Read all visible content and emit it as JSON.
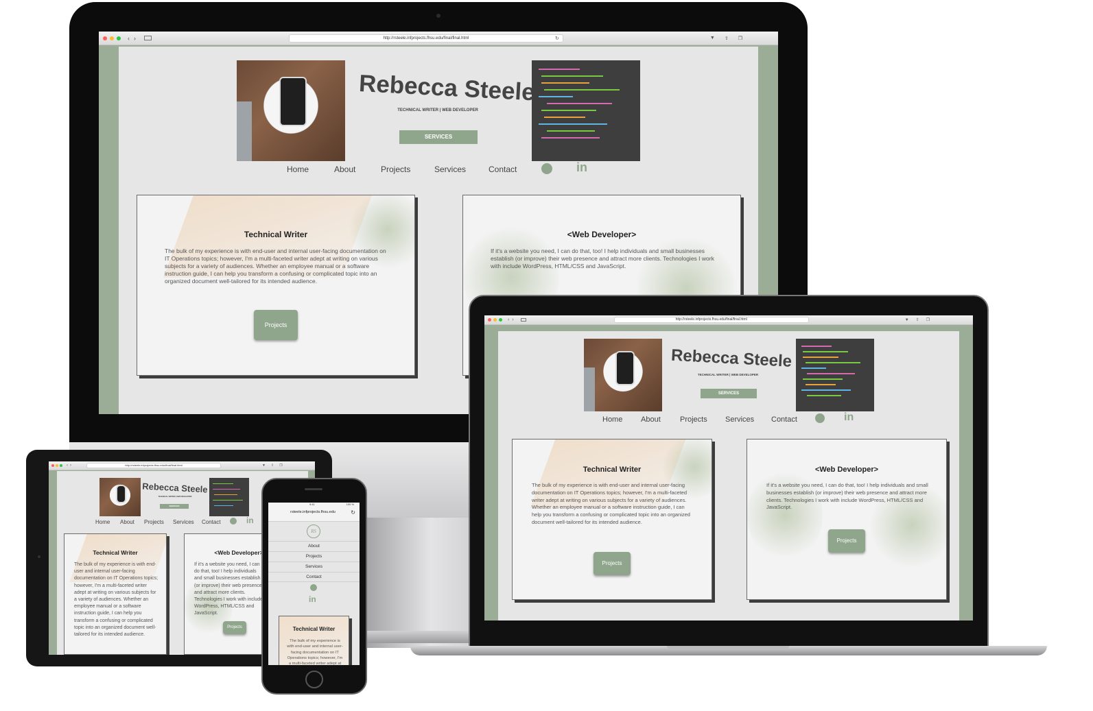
{
  "browser": {
    "url_desktop": "http://rsteele.infprojects.fhsu.edu/final/final.html",
    "url_mobile": "rsteele.infprojects.fhsu.edu",
    "phone_time": "9:41",
    "phone_battery": "100 %"
  },
  "site": {
    "name": "Rebecca Steele",
    "subtitle": "TECHNICAL WRITER | WEB DEVELOPER",
    "services_button": "SERVICES",
    "logo_initials": "RS",
    "nav": [
      "Home",
      "About",
      "Projects",
      "Services",
      "Contact"
    ],
    "mobile_menu": [
      "About",
      "Projects",
      "Services",
      "Contact"
    ],
    "social": {
      "github_icon": "github-icon",
      "linkedin_icon": "linkedin-icon",
      "linkedin_text": "in"
    }
  },
  "cards": {
    "tech": {
      "title": "Technical Writer",
      "body": "The bulk of my experience is with end-user and internal user-facing documentation on IT Operations topics; however, I'm a multi-faceted writer adept at writing on various subjects for a variety of audiences. Whether an employee manual or a software instruction guide, I can help you transform a confusing or complicated topic into an organized document well-tailored for its intended audience.",
      "button": "Projects"
    },
    "web": {
      "title": "<Web Developer>",
      "body": "If it's a website you need, I can do that, too! I help individuals and small businesses establish (or improve) their web presence and attract more clients. Technologies I work with include WordPress, HTML/CSS and JavaScript.",
      "button": "Projects"
    }
  },
  "colors": {
    "accent": "#8fa68c",
    "site_bg": "#e6e6e6",
    "frame_green": "#9bad97"
  }
}
